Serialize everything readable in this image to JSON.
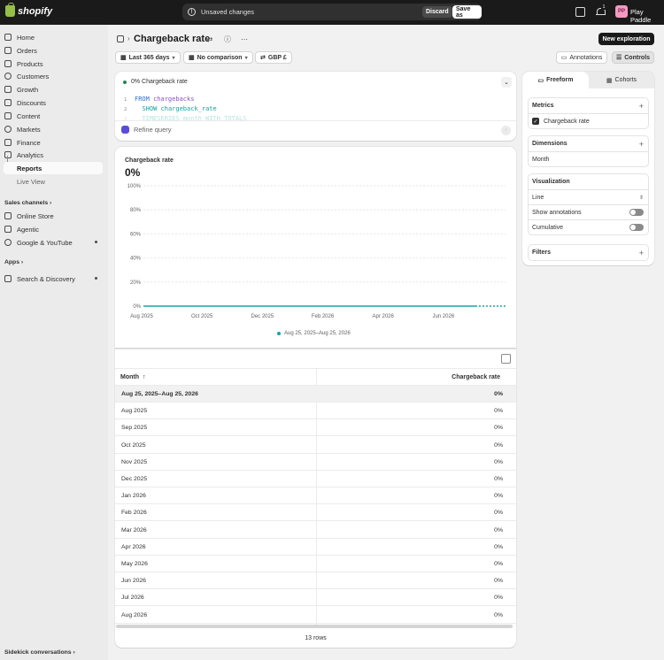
{
  "topbar": {
    "logo_text": "shopify",
    "unsaved_text": "Unsaved changes",
    "discard_label": "Discard",
    "save_as_label": "Save as",
    "notification_count": "1",
    "avatar_initials": "PP",
    "store_name": "Play Paddle"
  },
  "sidebar": {
    "items": [
      {
        "label": "Home"
      },
      {
        "label": "Orders"
      },
      {
        "label": "Products"
      },
      {
        "label": "Customers"
      },
      {
        "label": "Growth"
      },
      {
        "label": "Discounts"
      },
      {
        "label": "Content"
      },
      {
        "label": "Markets"
      },
      {
        "label": "Finance"
      },
      {
        "label": "Analytics"
      },
      {
        "label": "Reports"
      },
      {
        "label": "Live View"
      }
    ],
    "sales_channels_label": "Sales channels",
    "channels": [
      {
        "label": "Online Store"
      },
      {
        "label": "Agentic"
      },
      {
        "label": "Google & YouTube"
      }
    ],
    "apps_label": "Apps",
    "apps": [
      {
        "label": "Search & Discovery"
      }
    ],
    "sidekick_label": "Sidekick conversations"
  },
  "header": {
    "title": "Chargeback rate",
    "new_exploration_label": "New exploration",
    "date_range_label": "Last 365 days",
    "comparison_label": "No comparison",
    "currency_label": "GBP £",
    "annotations_label": "Annotations",
    "controls_label": "Controls"
  },
  "query": {
    "status_label": "0% Chargeback rate",
    "lines": [
      {
        "num": "1",
        "kw": "FROM",
        "val": "chargebacks"
      },
      {
        "num": "2",
        "kw": "SHOW",
        "val": "chargeback_rate"
      },
      {
        "num": "3",
        "kw": "TIMESERIES",
        "val": "month WITH TOTALS"
      }
    ],
    "refine_label": "Refine query"
  },
  "chart": {
    "metric_label": "Chargeback rate",
    "metric_value": "0%",
    "legend_label": "Aug 25, 2025–Aug 25, 2026"
  },
  "chart_data": {
    "type": "line",
    "title": "Chargeback rate",
    "x_ticks": [
      "Aug 2025",
      "Oct 2025",
      "Dec 2025",
      "Feb 2026",
      "Apr 2026",
      "Jun 2026"
    ],
    "y_ticks": [
      "100%",
      "80%",
      "60%",
      "40%",
      "20%",
      "0%"
    ],
    "ylim": [
      0,
      100
    ],
    "categories": [
      "Aug 2025",
      "Sep 2025",
      "Oct 2025",
      "Nov 2025",
      "Dec 2025",
      "Jan 2026",
      "Feb 2026",
      "Mar 2026",
      "Apr 2026",
      "May 2026",
      "Jun 2026",
      "Jul 2026",
      "Aug 2026"
    ],
    "series": [
      {
        "name": "Aug 25, 2025–Aug 25, 2026",
        "values": [
          0,
          0,
          0,
          0,
          0,
          0,
          0,
          0,
          0,
          0,
          0,
          0,
          0
        ],
        "color": "#19a1b0"
      }
    ],
    "grid": true
  },
  "table": {
    "col_month": "Month",
    "col_rate": "Chargeback rate",
    "total_row": {
      "month": "Aug 25, 2025–Aug 25, 2026",
      "rate": "0%"
    },
    "rows": [
      {
        "month": "Aug 2025",
        "rate": "0%"
      },
      {
        "month": "Sep 2025",
        "rate": "0%"
      },
      {
        "month": "Oct 2025",
        "rate": "0%"
      },
      {
        "month": "Nov 2025",
        "rate": "0%"
      },
      {
        "month": "Dec 2025",
        "rate": "0%"
      },
      {
        "month": "Jan 2026",
        "rate": "0%"
      },
      {
        "month": "Feb 2026",
        "rate": "0%"
      },
      {
        "month": "Mar 2026",
        "rate": "0%"
      },
      {
        "month": "Apr 2026",
        "rate": "0%"
      },
      {
        "month": "May 2026",
        "rate": "0%"
      },
      {
        "month": "Jun 2026",
        "rate": "0%"
      },
      {
        "month": "Jul 2026",
        "rate": "0%"
      },
      {
        "month": "Aug 2026",
        "rate": "0%"
      }
    ],
    "row_count_label": "13 rows"
  },
  "panel": {
    "tab_freeform": "Freeform",
    "tab_cohorts": "Cohorts",
    "metrics_label": "Metrics",
    "metric_item": "Chargeback rate",
    "dimensions_label": "Dimensions",
    "dimension_item": "Month",
    "visualization_label": "Visualization",
    "viz_type": "Line",
    "show_annotations_label": "Show annotations",
    "cumulative_label": "Cumulative",
    "filters_label": "Filters"
  }
}
